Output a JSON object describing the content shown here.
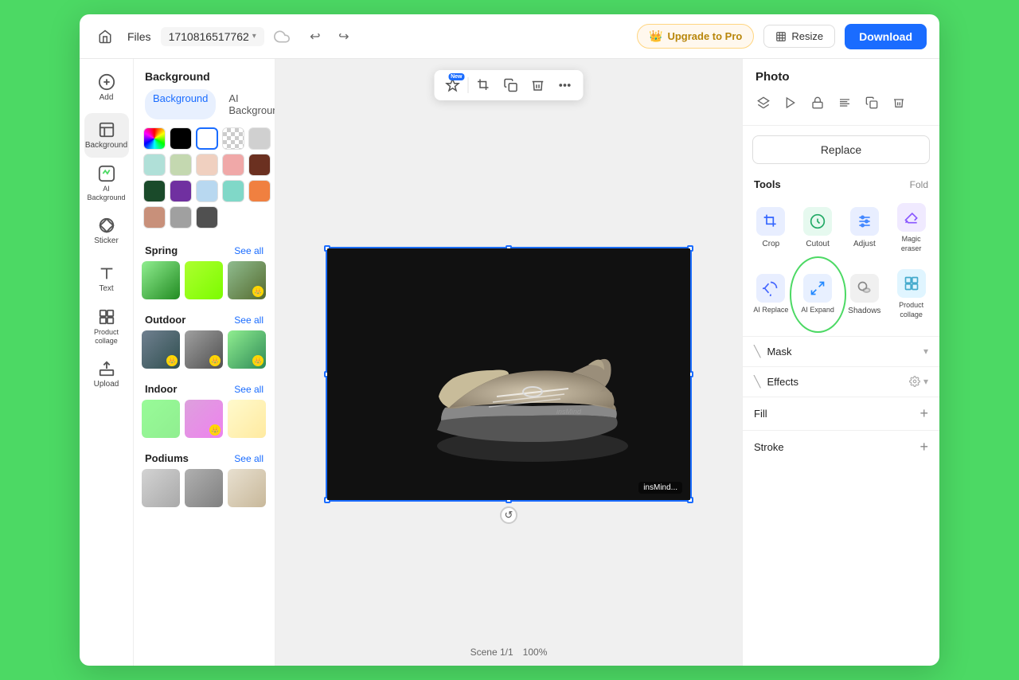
{
  "header": {
    "home_icon": "🏠",
    "files_label": "Files",
    "filename": "1710816517762",
    "cloud_icon": "☁",
    "undo_icon": "↩",
    "redo_icon": "↪",
    "upgrade_label": "Upgrade to Pro",
    "resize_label": "Resize",
    "download_label": "Download"
  },
  "left_sidebar": {
    "items": [
      {
        "id": "add",
        "icon": "add",
        "label": "Add"
      },
      {
        "id": "background",
        "icon": "background",
        "label": "Background",
        "active": true
      },
      {
        "id": "ai-background",
        "icon": "ai-bg",
        "label": "AI Background"
      },
      {
        "id": "sticker",
        "icon": "sticker",
        "label": "Sticker"
      },
      {
        "id": "text",
        "icon": "text",
        "label": "Text"
      },
      {
        "id": "product-collage",
        "icon": "collage",
        "label": "Product collage"
      },
      {
        "id": "upload",
        "icon": "upload",
        "label": "Upload"
      }
    ]
  },
  "panel": {
    "background_tab": "Background",
    "ai_background_tab": "AI Background",
    "sections": {
      "colors": {
        "swatches": [
          {
            "id": "gradient",
            "type": "gradient"
          },
          {
            "id": "black",
            "color": "#000000"
          },
          {
            "id": "white-selected",
            "color": "#FFFFFF",
            "selected": true
          },
          {
            "id": "transparent",
            "type": "transparent"
          },
          {
            "id": "light-gray",
            "color": "#D0D0D0"
          },
          {
            "id": "lavender",
            "color": "#B0B4E0"
          },
          {
            "id": "mint",
            "color": "#B0E0D8"
          },
          {
            "id": "sage",
            "color": "#C4D8B0"
          },
          {
            "id": "peach",
            "color": "#F0D0C0"
          },
          {
            "id": "pink",
            "color": "#F0A8A8"
          },
          {
            "id": "brown",
            "color": "#6B3020"
          },
          {
            "id": "dark-slate",
            "color": "#2A3A4A"
          },
          {
            "id": "dark-green",
            "color": "#1A4A2A"
          },
          {
            "id": "purple",
            "color": "#7030A0"
          },
          {
            "id": "sky-blue",
            "color": "#B8D8F0"
          },
          {
            "id": "teal",
            "color": "#80D8C8"
          },
          {
            "id": "orange",
            "color": "#F08040"
          },
          {
            "id": "salmon",
            "color": "#F08080"
          },
          {
            "id": "rose",
            "color": "#C8907A"
          },
          {
            "id": "medium-gray",
            "color": "#A0A0A0"
          },
          {
            "id": "dark-gray",
            "color": "#505050"
          }
        ]
      },
      "spring": {
        "label": "Spring",
        "see_all": "See all"
      },
      "outdoor": {
        "label": "Outdoor",
        "see_all": "See all"
      },
      "indoor": {
        "label": "Indoor",
        "see_all": "See all"
      },
      "podiums": {
        "label": "Podiums",
        "see_all": "See all"
      }
    }
  },
  "canvas": {
    "toolbar": {
      "ai_btn": "AI",
      "new_badge": "New",
      "crop_icon": "crop",
      "copy_icon": "copy",
      "delete_icon": "delete",
      "more_icon": "more"
    },
    "watermark": "insMind...",
    "bottom_bar": {
      "page_label": "Scene 1/1",
      "zoom_label": "100%"
    }
  },
  "right_panel": {
    "title": "Photo",
    "icons": [
      {
        "id": "layers",
        "icon": "layers"
      },
      {
        "id": "motion",
        "icon": "motion"
      },
      {
        "id": "lock",
        "icon": "lock"
      },
      {
        "id": "align",
        "icon": "align"
      },
      {
        "id": "duplicate",
        "icon": "duplicate"
      },
      {
        "id": "delete",
        "icon": "delete"
      }
    ],
    "replace_label": "Replace",
    "tools": {
      "title": "Tools",
      "fold_label": "Fold",
      "items": [
        {
          "id": "crop",
          "label": "Crop",
          "color": "#3366ff"
        },
        {
          "id": "cutout",
          "label": "Cutout",
          "color": "#22aa66"
        },
        {
          "id": "adjust",
          "label": "Adjust",
          "color": "#4488ff"
        },
        {
          "id": "magic-eraser",
          "label": "Magic eraser",
          "color": "#8855ff"
        },
        {
          "id": "ai-replace",
          "label": "AI Replace",
          "color": "#4466ff"
        },
        {
          "id": "ai-expand",
          "label": "AI Expand",
          "color": "#2288ff",
          "highlighted": true
        },
        {
          "id": "shadows",
          "label": "Shadows",
          "color": "#888888"
        },
        {
          "id": "product-collage",
          "label": "Product collage",
          "color": "#44aacc"
        }
      ]
    },
    "mask_label": "Mask",
    "effects_label": "Effects",
    "fill_label": "Fill",
    "stroke_label": "Stroke"
  }
}
